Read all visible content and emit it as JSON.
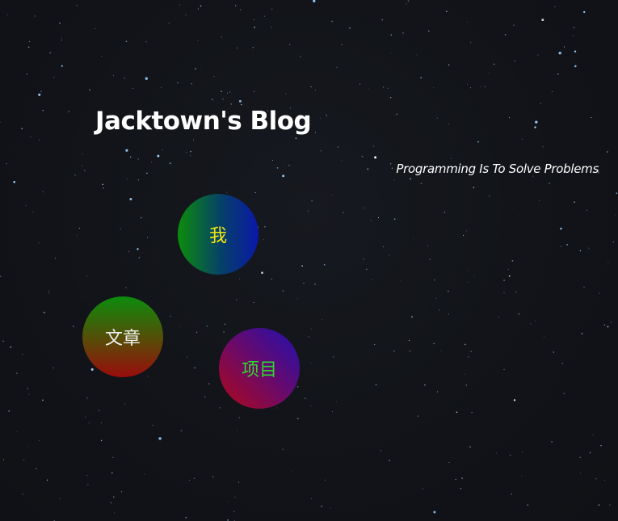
{
  "header": {
    "title": "Jacktown's Blog",
    "subtitle": "Programming Is To Solve Problems"
  },
  "nav": {
    "items": [
      {
        "id": "me",
        "label": "我"
      },
      {
        "id": "articles",
        "label": "文章"
      },
      {
        "id": "projects",
        "label": "项目"
      }
    ]
  },
  "colors": {
    "background": "#111318",
    "title_text": "#ffffff",
    "star": "#9fd4ff",
    "me_label": "#f2e512",
    "articles_label": "#f0f0f0",
    "projects_label": "#2ed82e"
  }
}
